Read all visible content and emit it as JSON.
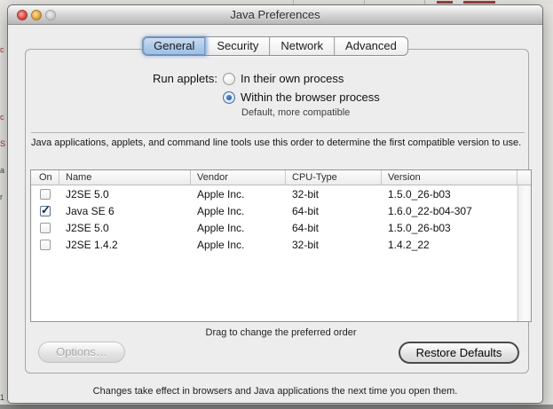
{
  "window": {
    "title": "Java Preferences"
  },
  "titlebar_buttons": {
    "close": "close",
    "minimize": "minimize",
    "zoom": "zoom"
  },
  "tabs": [
    {
      "label": "General",
      "selected": true
    },
    {
      "label": "Security",
      "selected": false
    },
    {
      "label": "Network",
      "selected": false
    },
    {
      "label": "Advanced",
      "selected": false
    }
  ],
  "run_applets": {
    "label": "Run applets:",
    "options": [
      {
        "label": "In their own process",
        "selected": false
      },
      {
        "label": "Within the browser process",
        "selected": true,
        "note": "Default, more compatible"
      }
    ]
  },
  "description": "Java applications, applets, and command line tools use this order to determine the first compatible version to use.",
  "table": {
    "columns": [
      "On",
      "Name",
      "Vendor",
      "CPU-Type",
      "Version"
    ],
    "rows": [
      {
        "on": false,
        "name": "J2SE 5.0",
        "vendor": "Apple Inc.",
        "cpu": "32-bit",
        "version": "1.5.0_26-b03"
      },
      {
        "on": true,
        "name": "Java SE 6",
        "vendor": "Apple Inc.",
        "cpu": "64-bit",
        "version": "1.6.0_22-b04-307"
      },
      {
        "on": false,
        "name": "J2SE 5.0",
        "vendor": "Apple Inc.",
        "cpu": "64-bit",
        "version": "1.5.0_26-b03"
      },
      {
        "on": false,
        "name": "J2SE 1.4.2",
        "vendor": "Apple Inc.",
        "cpu": "32-bit",
        "version": "1.4.2_22"
      }
    ]
  },
  "drag_hint": "Drag to change the preferred order",
  "buttons": {
    "options_label": "Options…",
    "options_disabled": true,
    "restore_label": "Restore Defaults"
  },
  "footer": "Changes take effect in browsers and Java applications the next time you open them.",
  "icons": {
    "check": "✓"
  },
  "colors": {
    "tab_selected_fill": "#aac8e8",
    "radio_selected": "#1d4f9e",
    "window_bg": "#ededed",
    "close_red": "#d9473c",
    "minimize_yellow": "#dfa23a"
  }
}
